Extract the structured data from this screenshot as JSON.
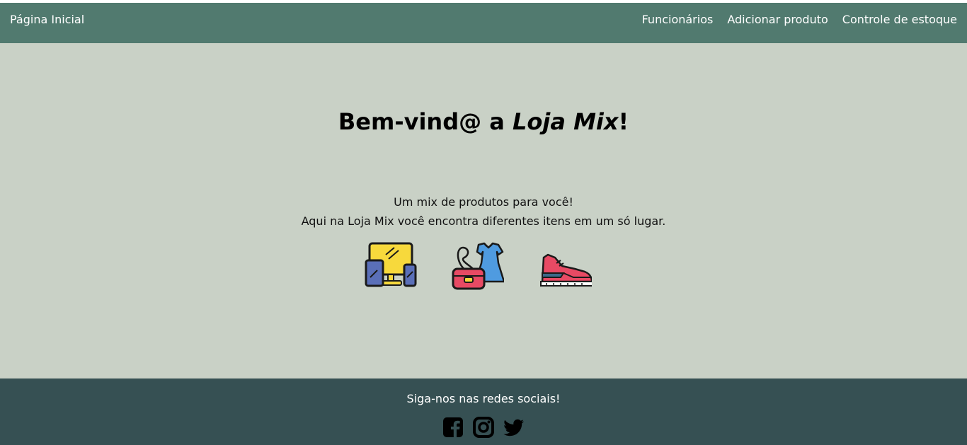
{
  "nav": {
    "home": "Página Inicial",
    "links": [
      "Funcionários",
      "Adicionar produto",
      "Controle de estoque"
    ]
  },
  "hero": {
    "title_prefix": "Bem-vind@ a ",
    "title_brand": "Loja Mix",
    "title_suffix": "!",
    "line1": "Um mix de produtos para você!",
    "line2": "Aqui na Loja Mix você encontra diferentes itens em um só lugar.",
    "category_icons": [
      "electronics-icon",
      "clothing-bag-icon",
      "sneaker-icon"
    ]
  },
  "footer": {
    "follow_text": "Siga-nos nas redes sociais!",
    "social_icons": [
      "facebook-icon",
      "instagram-icon",
      "twitter-icon"
    ]
  },
  "colors": {
    "navbar": "#517a6f",
    "main_bg": "#c9d1c6",
    "footer_bg": "#365053"
  }
}
